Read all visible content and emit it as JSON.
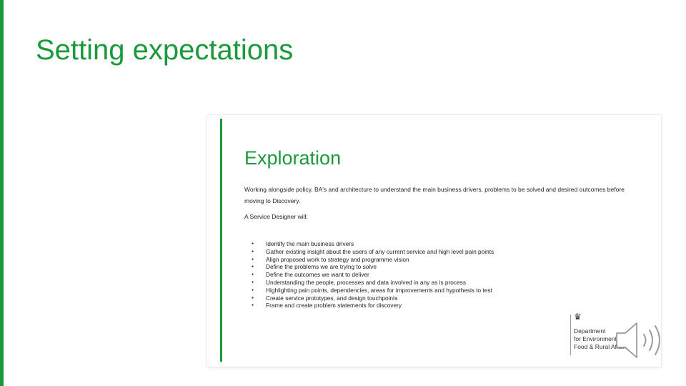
{
  "slide": {
    "title": "Setting expectations"
  },
  "embedded_slide": {
    "title": "Exploration",
    "intro": "Working alongside policy, BA's and architecture to understand the main business drivers, problems to be solved and desired outcomes before moving to Discovery.",
    "lead": "A Service Designer will:",
    "bullets": [
      "Identify the main business drivers",
      "Gather existing insight about the users of any current service and high level pain points",
      "Align proposed work to strategy and programme vision",
      "Define the problems we are trying to solve",
      "Define the outcomes we want to deliver",
      "Understanding the people, processes and data involved in any as is process",
      "Highlighting pain points, dependencies, areas for improvements and hypothesis to test",
      "Create service prototypes, and design touchpoints",
      "Frame and create problem statements for discovery"
    ],
    "logo": {
      "line1": "Department",
      "line2": "for Environment",
      "line3": "Food & Rural Affairs",
      "icon": "royal-crest-icon"
    }
  },
  "audio": {
    "icon": "speaker-icon"
  },
  "colors": {
    "accent": "#1a9a3c"
  }
}
